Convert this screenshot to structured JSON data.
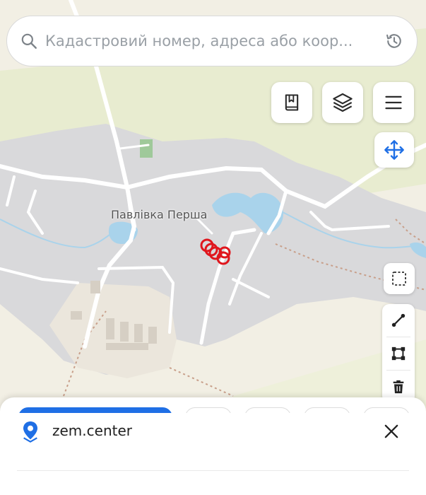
{
  "search": {
    "placeholder": "Кадастровий номер, адреса або коор..."
  },
  "map": {
    "place_label": "Павлівка Перша",
    "colors": {
      "land": "#f2efe4",
      "fields": "#e8ecd0",
      "settlement": "#d9d9db",
      "water": "#a9d3eb",
      "roads": "#ffffff",
      "markers": "#e0161d"
    }
  },
  "controls": {
    "top": [
      "bookmark-icon",
      "layers-icon",
      "menu-icon"
    ],
    "move": "move-arrows-icon",
    "select": "select-area-icon",
    "draw": [
      "draw-line-icon",
      "draw-polygon-icon",
      "trash-icon"
    ]
  },
  "sheet": {
    "title": "zem.center",
    "logo": "location-pin-icon",
    "close": "close-icon"
  }
}
